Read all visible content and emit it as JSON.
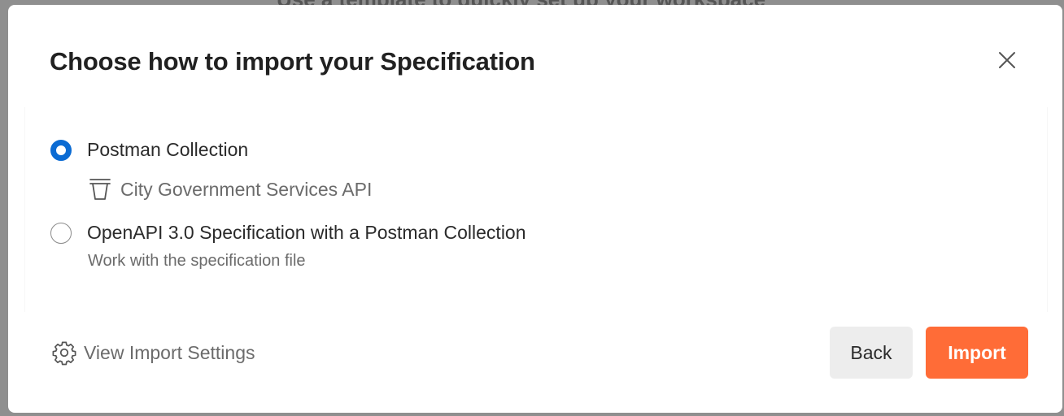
{
  "backdrop": {
    "heading": "Use a template to quickly set up your workspace"
  },
  "dialog": {
    "title": "Choose how to import your Specification",
    "close_icon": "close-icon"
  },
  "options": [
    {
      "label": "Postman Collection",
      "selected": true,
      "collection": {
        "icon": "collection-trash-icon",
        "name": "City Government Services API"
      }
    },
    {
      "label": "OpenAPI 3.0 Specification with a Postman Collection",
      "selected": false,
      "description": "Work with the specification file"
    }
  ],
  "footer": {
    "settings_label": "View Import Settings",
    "settings_icon": "gear-icon",
    "back_label": "Back",
    "import_label": "Import"
  },
  "colors": {
    "accent": "#ff6c37",
    "radio_selected": "#0b6bd3"
  }
}
